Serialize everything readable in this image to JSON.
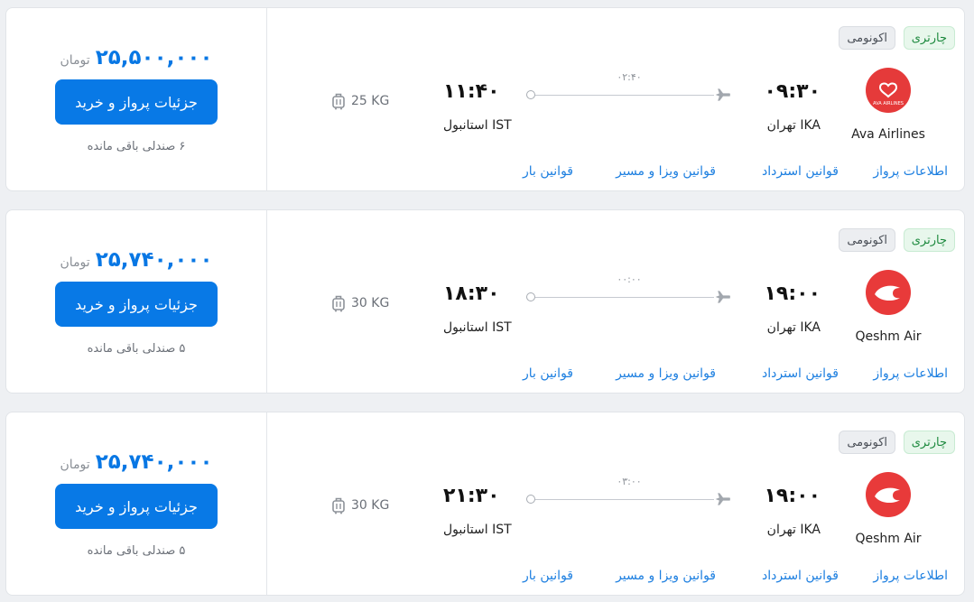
{
  "flights": [
    {
      "tags": {
        "charter": "چارتری",
        "class": "اکونومی"
      },
      "airline": {
        "name": "Ava Airlines",
        "logo_text": "AVA AIRLINES",
        "logo_color": "#e53a3a",
        "logo_icon": "ava-heart-logo"
      },
      "departure": {
        "time": "۰۹:۳۰",
        "city": "تهران IKA"
      },
      "arrival": {
        "time": "۱۱:۴۰",
        "city": "استانبول IST"
      },
      "duration": "۰۲:۴۰",
      "baggage": "25 KG",
      "price": {
        "amount": "۲۵,۵۰۰,۰۰۰",
        "currency": "تومان"
      },
      "button": "جزئیات پرواز و خرید",
      "seats": "۶ صندلی باقی مانده",
      "links": {
        "info": "اطلاعات پرواز",
        "refund": "قوانین استرداد",
        "visa": "قوانین ویزا و مسیر",
        "baggage": "قوانین بار"
      }
    },
    {
      "tags": {
        "charter": "چارتری",
        "class": "اکونومی"
      },
      "airline": {
        "name": "Qeshm Air",
        "logo_color": "#e83a3a",
        "logo_icon": "qeshm-air-logo"
      },
      "departure": {
        "time": "۱۹:۰۰",
        "city": "تهران IKA"
      },
      "arrival": {
        "time": "۱۸:۳۰",
        "city": "استانبول IST"
      },
      "duration": "۰۰:۰۰",
      "baggage": "30 KG",
      "price": {
        "amount": "۲۵,۷۴۰,۰۰۰",
        "currency": "تومان"
      },
      "button": "جزئیات پرواز و خرید",
      "seats": "۵ صندلی باقی مانده",
      "links": {
        "info": "اطلاعات پرواز",
        "refund": "قوانین استرداد",
        "visa": "قوانین ویزا و مسیر",
        "baggage": "قوانین بار"
      }
    },
    {
      "tags": {
        "charter": "چارتری",
        "class": "اکونومی"
      },
      "airline": {
        "name": "Qeshm Air",
        "logo_color": "#e83a3a",
        "logo_icon": "qeshm-air-logo"
      },
      "departure": {
        "time": "۱۹:۰۰",
        "city": "تهران IKA"
      },
      "arrival": {
        "time": "۲۱:۳۰",
        "city": "استانبول IST"
      },
      "duration": "۰۳:۰۰",
      "baggage": "30 KG",
      "price": {
        "amount": "۲۵,۷۴۰,۰۰۰",
        "currency": "تومان"
      },
      "button": "جزئیات پرواز و خرید",
      "seats": "۵ صندلی باقی مانده",
      "links": {
        "info": "اطلاعات پرواز",
        "refund": "قوانین استرداد",
        "visa": "قوانین ویزا و مسیر",
        "baggage": "قوانین بار"
      }
    }
  ],
  "colors": {
    "accent": "#0879e6",
    "link": "#1d7fe0",
    "charter_bg": "#e8f7ec",
    "charter_text": "#1e8a3f"
  }
}
